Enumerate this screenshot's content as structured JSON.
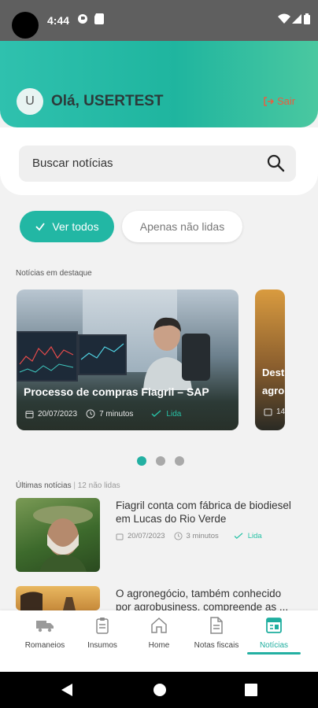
{
  "status_bar": {
    "time": "4:44"
  },
  "header": {
    "avatar_initial": "U",
    "greeting": "Olá, USERTEST",
    "logout_label": "Sair"
  },
  "search": {
    "placeholder": "Buscar notícias"
  },
  "filters": {
    "all_label": "Ver todos",
    "unread_label": "Apenas não lidas"
  },
  "featured": {
    "section_label": "Notícias em destaque",
    "cards": [
      {
        "title": "Processo de compras Fiagril – SAP",
        "date": "20/07/2023",
        "read_time": "7 minutos",
        "status": "Lida"
      },
      {
        "title_line1": "Dest",
        "title_line2": "agrob",
        "date": "14"
      }
    ],
    "active_dot": 0,
    "dot_count": 3
  },
  "latest": {
    "label": "Últimas notícias",
    "unread_count": "12 não lidas",
    "items": [
      {
        "title": "Fiagril conta com fábrica de biodiesel em Lucas do Rio Verde",
        "date": "20/07/2023",
        "read_time": "3 minutos",
        "status": "Lida"
      },
      {
        "title": "O agronegócio, também conhecido por agrobusiness, compreende as ..."
      }
    ]
  },
  "bottom_nav": [
    {
      "label": "Romaneios",
      "icon": "truck-icon"
    },
    {
      "label": "Insumos",
      "icon": "clipboard-icon"
    },
    {
      "label": "Home",
      "icon": "home-icon"
    },
    {
      "label": "Notas fiscais",
      "icon": "document-icon"
    },
    {
      "label": "Notícias",
      "icon": "newspaper-icon",
      "active": true
    }
  ],
  "colors": {
    "accent": "#22b7a4",
    "logout": "#ef5a3c",
    "header_gradient_start": "#2fc1ae",
    "header_gradient_end": "#4ac8a0"
  }
}
